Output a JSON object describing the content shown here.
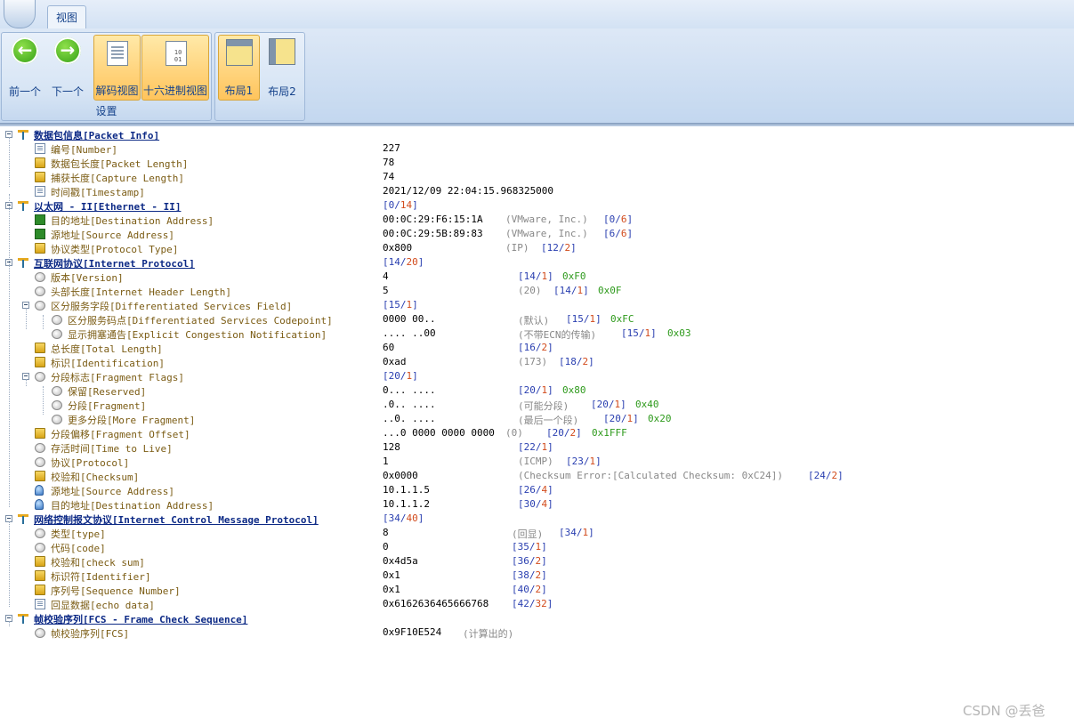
{
  "ribbon": {
    "tab_label": "视图",
    "prev_label": "前一个",
    "next_label": "下一个",
    "decode_view_label": "解码视图",
    "hex_view_label": "十六进制视图",
    "settings_group_caption": "设置",
    "layout1_label": "布局1",
    "layout2_label": "布局2"
  },
  "tree": {
    "rows": [
      {
        "kind": "header",
        "label": "数据包信息[Packet Info]"
      },
      {
        "kind": "field",
        "icon": "doc",
        "label": "编号[Number]",
        "value": "227"
      },
      {
        "kind": "field",
        "icon": "stack",
        "label": "数据包长度[Packet Length]",
        "value": "78"
      },
      {
        "kind": "field",
        "icon": "stack",
        "label": "捕获长度[Capture Length]",
        "value": "74"
      },
      {
        "kind": "field",
        "icon": "doc",
        "label": "时间戳[Timestamp]",
        "value": "2021/12/09 22:04:15.968325000"
      },
      {
        "kind": "header",
        "label": "以太网 - II[Ethernet - II]",
        "offset": "0",
        "len": "14"
      },
      {
        "kind": "field",
        "icon": "net",
        "label": "目的地址[Destination Address]",
        "value": "00:0C:29:F6:15:1A",
        "note": "(VMware, Inc.)",
        "offset": "0",
        "len": "6"
      },
      {
        "kind": "field",
        "icon": "net",
        "label": "源地址[Source Address]",
        "value": "00:0C:29:5B:89:83",
        "note": "(VMware, Inc.)",
        "offset": "6",
        "len": "6"
      },
      {
        "kind": "field",
        "icon": "stack",
        "label": "协议类型[Protocol Type]",
        "value": "0x800",
        "note": "(IP)",
        "offset": "12",
        "len": "2"
      },
      {
        "kind": "header",
        "label": "互联网协议[Internet Protocol]",
        "offset": "14",
        "len": "20"
      },
      {
        "kind": "field",
        "icon": "oval",
        "label": "版本[Version]",
        "value": "4",
        "offset": "14",
        "len": "1",
        "hex": "0xF0"
      },
      {
        "kind": "field",
        "icon": "oval",
        "label": "头部长度[Internet Header Length]",
        "value": "5",
        "note": "(20)",
        "offset": "14",
        "len": "1",
        "hex": "0x0F"
      },
      {
        "kind": "field",
        "icon": "oval",
        "label": "区分服务字段[Differentiated Services Field]",
        "value": "",
        "offset": "15",
        "len": "1"
      },
      {
        "kind": "field",
        "icon": "oval",
        "label": "区分服务码点[Differentiated Services Codepoint]",
        "value": "0000 00..",
        "note": "(默认)",
        "offset": "15",
        "len": "1",
        "hex": "0xFC"
      },
      {
        "kind": "field",
        "icon": "oval",
        "label": "显示拥塞通告[Explicit Congestion Notification]",
        "value": ".... ..00",
        "note": "(不带ECN的传输)",
        "offset": "15",
        "len": "1",
        "hex": "0x03"
      },
      {
        "kind": "field",
        "icon": "stack",
        "label": "总长度[Total Length]",
        "value": "60",
        "offset": "16",
        "len": "2"
      },
      {
        "kind": "field",
        "icon": "stack",
        "label": "标识[Identification]",
        "value": "0xad",
        "note": "(173)",
        "offset": "18",
        "len": "2"
      },
      {
        "kind": "field",
        "icon": "oval",
        "label": "分段标志[Fragment Flags]",
        "value": "",
        "offset": "20",
        "len": "1"
      },
      {
        "kind": "field",
        "icon": "oval",
        "label": "保留[Reserved]",
        "value": "0... ....",
        "offset": "20",
        "len": "1",
        "hex": "0x80"
      },
      {
        "kind": "field",
        "icon": "oval",
        "label": "分段[Fragment]",
        "value": ".0.. ....",
        "note": "(可能分段)",
        "offset": "20",
        "len": "1",
        "hex": "0x40"
      },
      {
        "kind": "field",
        "icon": "oval",
        "label": "更多分段[More Fragment]",
        "value": "..0. ....",
        "note": "(最后一个段)",
        "offset": "20",
        "len": "1",
        "hex": "0x20"
      },
      {
        "kind": "field",
        "icon": "stack",
        "label": "分段偏移[Fragment Offset]",
        "value": "...0 0000 0000 0000",
        "note": "(0)",
        "offset": "20",
        "len": "2",
        "hex": "0x1FFF"
      },
      {
        "kind": "field",
        "icon": "oval",
        "label": "存活时间[Time to Live]",
        "value": "128",
        "offset": "22",
        "len": "1"
      },
      {
        "kind": "field",
        "icon": "oval",
        "label": "协议[Protocol]",
        "value": "1",
        "note": "(ICMP)",
        "offset": "23",
        "len": "1"
      },
      {
        "kind": "field",
        "icon": "stack",
        "label": "校验和[Checksum]",
        "value": "0x0000",
        "note": "(Checksum Error:[Calculated Checksum: 0xC24])",
        "offset": "24",
        "len": "2"
      },
      {
        "kind": "field",
        "icon": "pc",
        "label": "源地址[Source Address]",
        "value": "10.1.1.5",
        "offset": "26",
        "len": "4"
      },
      {
        "kind": "field",
        "icon": "pc",
        "label": "目的地址[Destination Address]",
        "value": "10.1.1.2",
        "offset": "30",
        "len": "4"
      },
      {
        "kind": "header",
        "label": "网络控制报文协议[Internet Control Message Protocol]",
        "offset": "34",
        "len": "40"
      },
      {
        "kind": "field",
        "icon": "oval",
        "label": "类型[type]",
        "value": "8",
        "note": "(回显)",
        "offset": "34",
        "len": "1"
      },
      {
        "kind": "field",
        "icon": "oval",
        "label": "代码[code]",
        "value": "0",
        "offset": "35",
        "len": "1"
      },
      {
        "kind": "field",
        "icon": "stack",
        "label": "校验和[check sum]",
        "value": "0x4d5a",
        "offset": "36",
        "len": "2"
      },
      {
        "kind": "field",
        "icon": "stack",
        "label": "标识符[Identifier]",
        "value": "0x1",
        "offset": "38",
        "len": "2"
      },
      {
        "kind": "field",
        "icon": "stack",
        "label": "序列号[Sequence Number]",
        "value": "0x1",
        "offset": "40",
        "len": "2"
      },
      {
        "kind": "field",
        "icon": "doc",
        "label": "回显数据[echo data]",
        "value": "0x6162636465666768",
        "offset": "42",
        "len": "32"
      },
      {
        "kind": "header",
        "label": "帧校验序列[FCS - Frame Check Sequence]"
      },
      {
        "kind": "field",
        "icon": "oval",
        "label": "帧校验序列[FCS]",
        "value": "0x9F10E524",
        "note": "(计算出的)"
      }
    ]
  },
  "watermark": "CSDN @丢爸"
}
